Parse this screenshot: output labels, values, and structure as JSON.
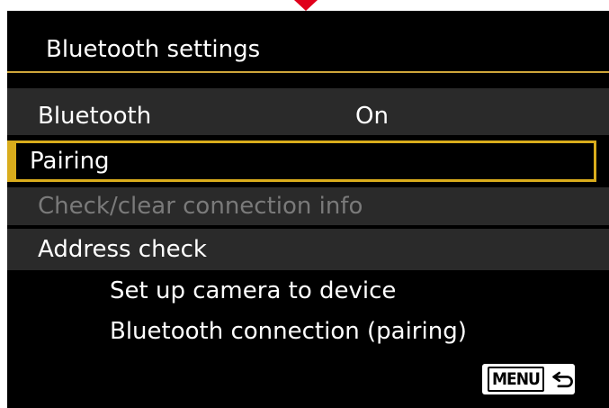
{
  "header": {
    "title": "Bluetooth settings"
  },
  "menu": {
    "items": [
      {
        "label": "Bluetooth",
        "value": "On",
        "state": "normal"
      },
      {
        "label": "Pairing",
        "value": "",
        "state": "selected"
      },
      {
        "label": "Check/clear connection info",
        "value": "",
        "state": "disabled"
      },
      {
        "label": "Address check",
        "value": "",
        "state": "normal"
      }
    ]
  },
  "description": {
    "line1": "Set up camera to device",
    "line2": "Bluetooth connection (pairing)"
  },
  "footer": {
    "menu_button_label": "MENU",
    "return_icon": "return-arrow-icon"
  },
  "colors": {
    "screen_background": "#000000",
    "row_background": "#2a2a2a",
    "selection_highlight": "#d9ac1c",
    "title_rule": "#cfa63a",
    "disabled_text": "#7a7a7a",
    "indicator": "#e0001b"
  }
}
